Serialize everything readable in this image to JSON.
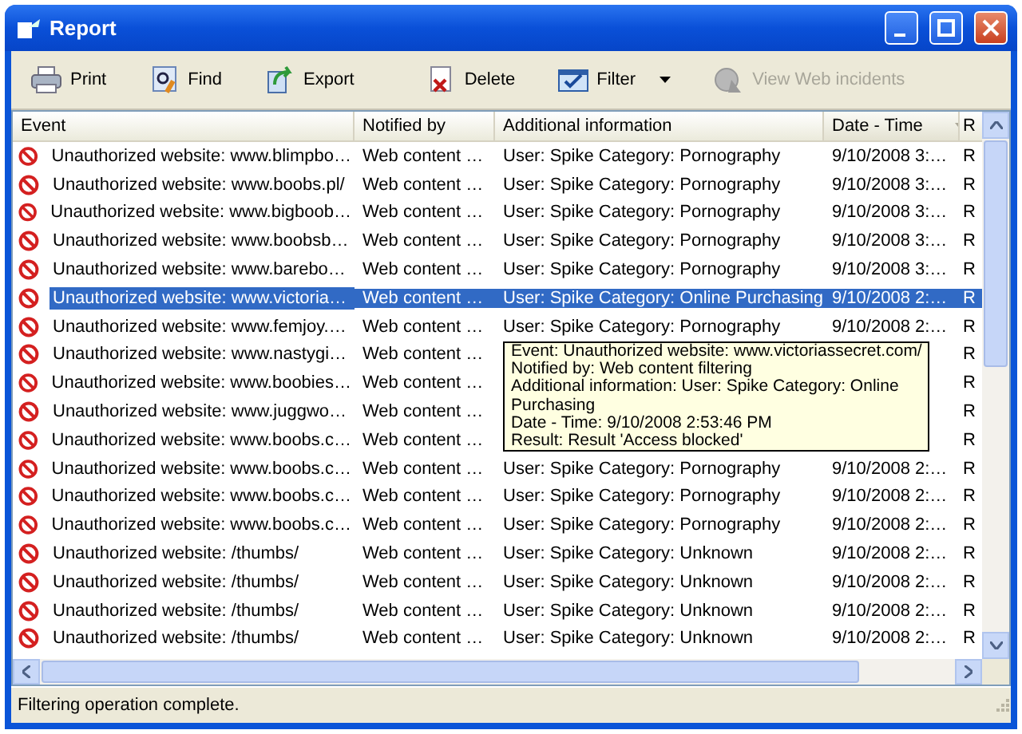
{
  "window": {
    "title": "Report"
  },
  "toolbar": [
    {
      "label": "Print",
      "kind": "button",
      "disabled": false
    },
    {
      "label": "Find",
      "kind": "button",
      "disabled": false
    },
    {
      "label": "Export",
      "kind": "button",
      "disabled": false
    },
    {
      "label": "Delete",
      "kind": "button",
      "disabled": false
    },
    {
      "label": "Filter",
      "kind": "dropdown",
      "disabled": false
    },
    {
      "label": "View Web incidents",
      "kind": "button",
      "disabled": true
    }
  ],
  "table": {
    "columns": [
      {
        "label": "Event",
        "sorted": false
      },
      {
        "label": "Notified by",
        "sorted": false
      },
      {
        "label": "Additional information",
        "sorted": false
      },
      {
        "label": "Date - Time",
        "sorted": true
      },
      {
        "label": "R",
        "sorted": false
      }
    ],
    "rows": [
      {
        "event": "Unauthorized website: www.blimpbo…",
        "notified_by": "Web content …",
        "additional_information": "User: Spike Category: Pornography",
        "date_time": "9/10/2008 3:…",
        "column_5": "R",
        "selected": false
      },
      {
        "event": "Unauthorized website: www.boobs.pl/",
        "notified_by": "Web content …",
        "additional_information": "User: Spike Category: Pornography",
        "date_time": "9/10/2008 3:…",
        "column_5": "R",
        "selected": false
      },
      {
        "event": "Unauthorized website: www.bigboob…",
        "notified_by": "Web content …",
        "additional_information": "User: Spike Category: Pornography",
        "date_time": "9/10/2008 3:…",
        "column_5": "R",
        "selected": false
      },
      {
        "event": "Unauthorized website: www.boobsb…",
        "notified_by": "Web content …",
        "additional_information": "User: Spike Category: Pornography",
        "date_time": "9/10/2008 3:…",
        "column_5": "R",
        "selected": false
      },
      {
        "event": "Unauthorized website: www.barebo…",
        "notified_by": "Web content …",
        "additional_information": "User: Spike Category: Pornography",
        "date_time": "9/10/2008 3:…",
        "column_5": "R",
        "selected": false
      },
      {
        "event": "Unauthorized website: www.victoria…",
        "notified_by": "Web content …",
        "additional_information": "User: Spike Category: Online Purchasing",
        "date_time": "9/10/2008 2:…",
        "column_5": "R",
        "selected": true
      },
      {
        "event": "Unauthorized website: www.femjoy.…",
        "notified_by": "Web content …",
        "additional_information": "User: Spike Category: Pornography",
        "date_time": "9/10/2008 2:…",
        "column_5": "R",
        "selected": false
      },
      {
        "event": "Unauthorized website: www.nastygi…",
        "notified_by": "Web content …",
        "column_5": "R",
        "selected": false
      },
      {
        "event": "Unauthorized website: www.boobies…",
        "notified_by": "Web content …",
        "column_5": "R",
        "selected": false
      },
      {
        "event": "Unauthorized website: www.juggwo…",
        "notified_by": "Web content …",
        "column_5": "R",
        "selected": false
      },
      {
        "event": "Unauthorized website: www.boobs.c…",
        "notified_by": "Web content …",
        "column_5": "R",
        "selected": false
      },
      {
        "event": "Unauthorized website: www.boobs.c…",
        "notified_by": "Web content …",
        "additional_information": "User: Spike Category: Pornography",
        "date_time": "9/10/2008 2:…",
        "column_5": "R",
        "selected": false
      },
      {
        "event": "Unauthorized website: www.boobs.c…",
        "notified_by": "Web content …",
        "additional_information": "User: Spike Category: Pornography",
        "date_time": "9/10/2008 2:…",
        "column_5": "R",
        "selected": false
      },
      {
        "event": "Unauthorized website: www.boobs.c…",
        "notified_by": "Web content …",
        "additional_information": "User: Spike Category: Pornography",
        "date_time": "9/10/2008 2:…",
        "column_5": "R",
        "selected": false
      },
      {
        "event": "Unauthorized website: /thumbs/",
        "notified_by": "Web content …",
        "additional_information": "User: Spike Category: Unknown",
        "date_time": "9/10/2008 2:…",
        "column_5": "R",
        "selected": false
      },
      {
        "event": "Unauthorized website: /thumbs/",
        "notified_by": "Web content …",
        "additional_information": "User: Spike Category: Unknown",
        "date_time": "9/10/2008 2:…",
        "column_5": "R",
        "selected": false
      },
      {
        "event": "Unauthorized website: /thumbs/",
        "notified_by": "Web content …",
        "additional_information": "User: Spike Category: Unknown",
        "date_time": "9/10/2008 2:…",
        "column_5": "R",
        "selected": false
      },
      {
        "event": "Unauthorized website: /thumbs/",
        "notified_by": "Web content …",
        "additional_information": "User: Spike Category: Unknown",
        "date_time": "9/10/2008 2:…",
        "column_5": "R",
        "selected": false
      }
    ]
  },
  "tooltip": {
    "lines": [
      "Event: Unauthorized website: www.victoriassecret.com/",
      "Notified by: Web content filtering",
      "Additional information: User: Spike Category: Online",
      "Purchasing",
      "Date - Time: 9/10/2008 2:53:46 PM",
      "Result: Result 'Access blocked'"
    ]
  },
  "status_bar": "Filtering operation complete."
}
